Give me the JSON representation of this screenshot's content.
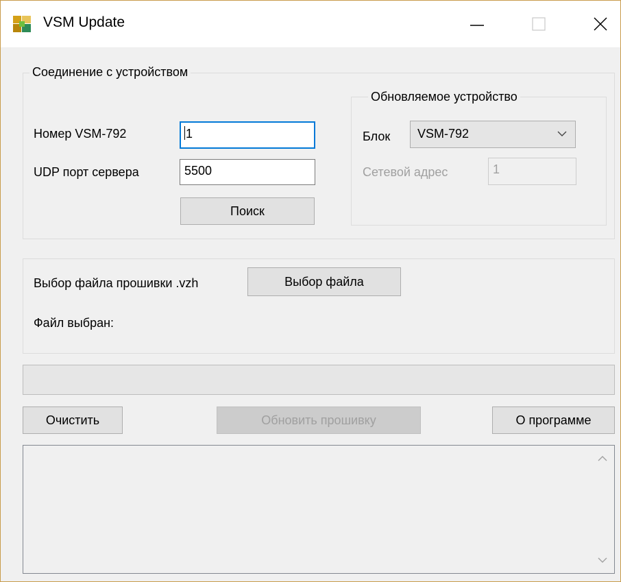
{
  "window": {
    "title": "VSM Update",
    "app_icon": "vsm-app-icon"
  },
  "connection": {
    "title": "Соединение с устройством",
    "number_label": "Номер VSM-792",
    "number_value": "1",
    "udp_label": "UDP порт сервера",
    "udp_value": "5500",
    "search_button": "Поиск"
  },
  "device": {
    "title": "Обновляемое устройство",
    "block_label": "Блок",
    "block_value": "VSM-792",
    "address_label": "Сетевой адрес",
    "address_value": "1"
  },
  "firmware": {
    "select_label": "Выбор файла прошивки .vzh",
    "select_button": "Выбор файла",
    "selected_label": "Файл выбран:"
  },
  "progress": {
    "value_percent": 0,
    "fill_color": "#06b025"
  },
  "actions": {
    "clear_button": "Очистить",
    "update_button": "Обновить прошивку",
    "about_button": "О программе"
  },
  "log": {
    "text": ""
  }
}
